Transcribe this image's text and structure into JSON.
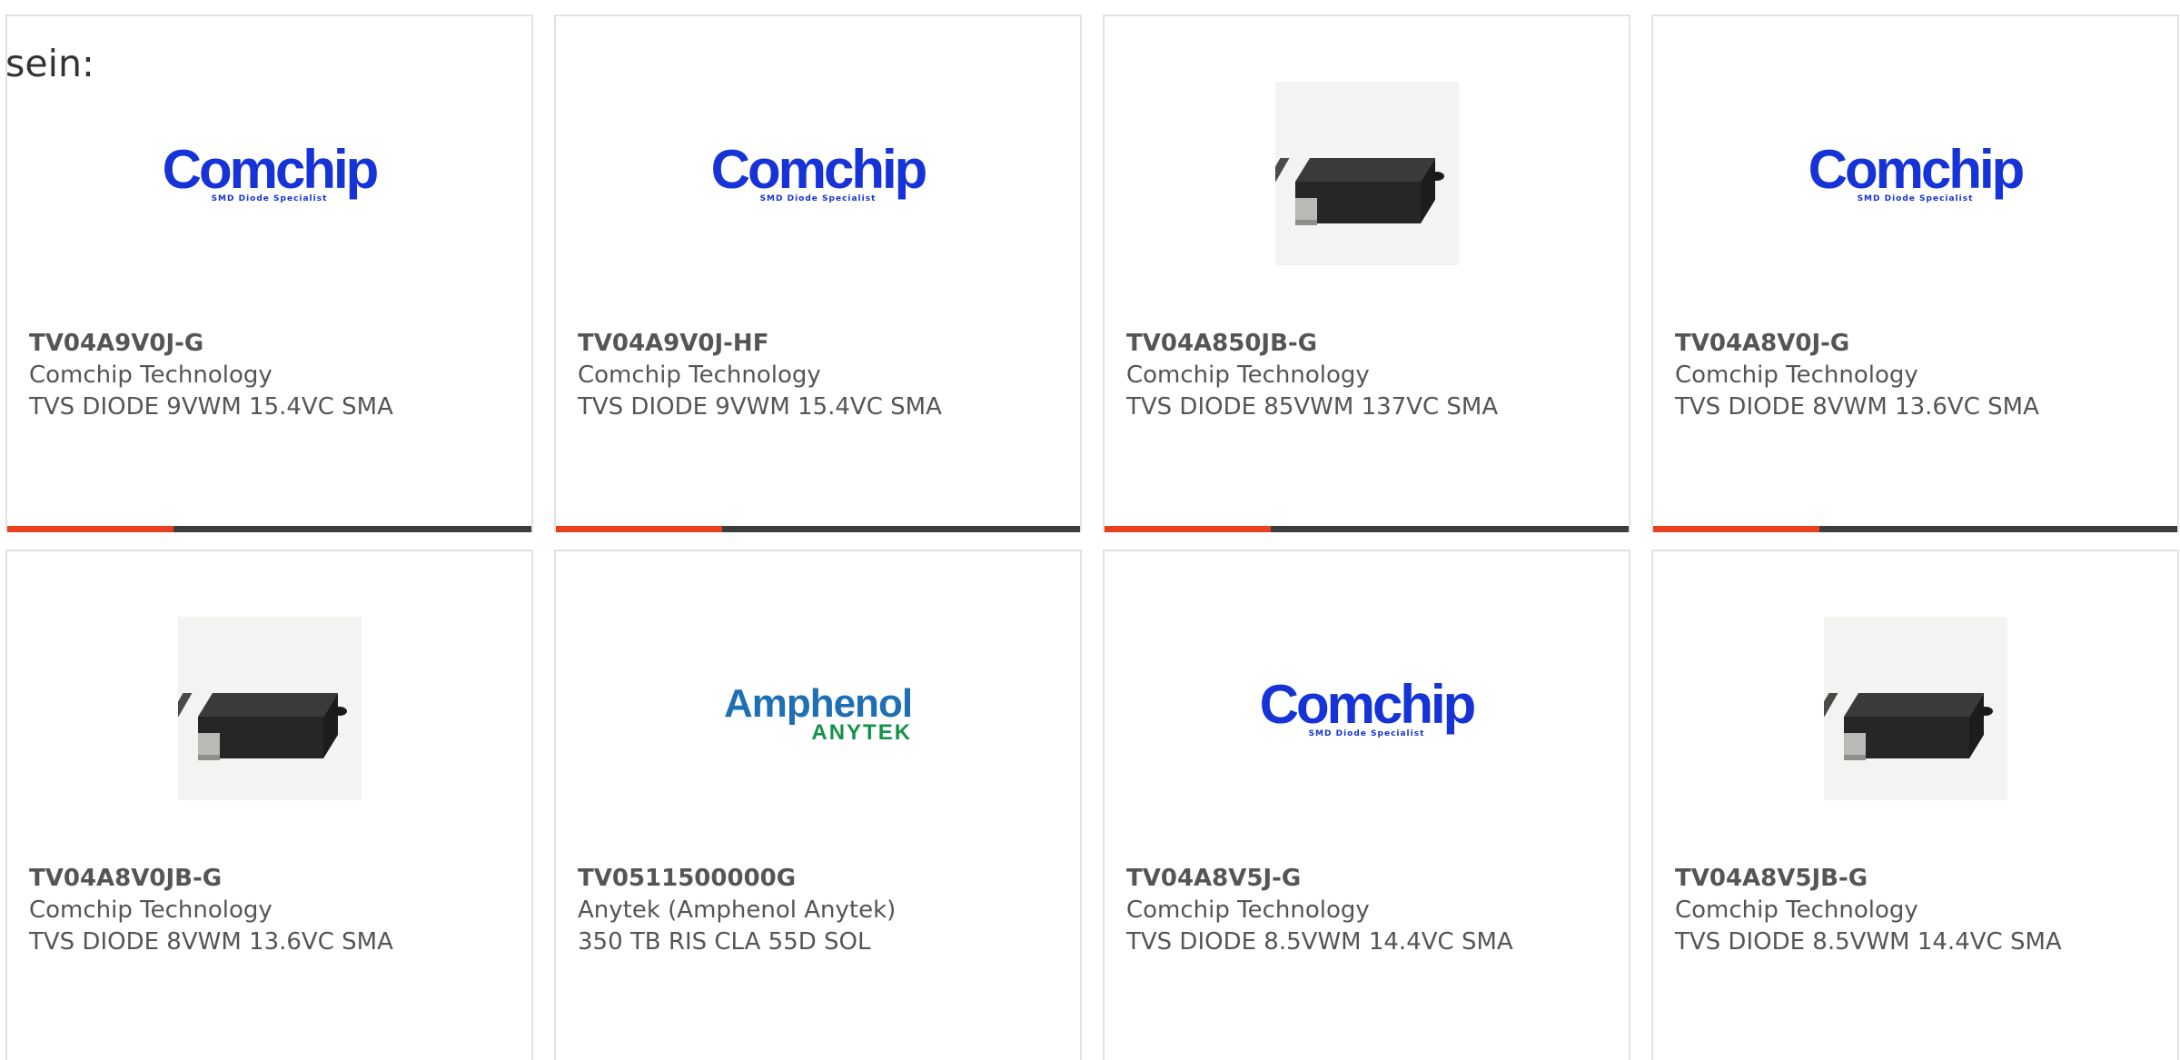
{
  "intro_text": "sein:",
  "accent_color": "#e8401e",
  "bar_color": "#3d3d3d",
  "logos": {
    "comchip": {
      "word": "Comchip",
      "tag": "SMD Diode Specialist"
    },
    "amphenol": {
      "word": "Amphenol",
      "sub": "ANYTEK"
    }
  },
  "products": [
    {
      "part_number": "TV04A9V0J-G",
      "manufacturer": "Comchip Technology",
      "description": "TVS DIODE 9VWM 15.4VC SMA",
      "image": "comchip-logo"
    },
    {
      "part_number": "TV04A9V0J-HF",
      "manufacturer": "Comchip Technology",
      "description": "TVS DIODE 9VWM 15.4VC SMA",
      "image": "comchip-logo"
    },
    {
      "part_number": "TV04A850JB-G",
      "manufacturer": "Comchip Technology",
      "description": "TVS DIODE 85VWM 137VC SMA",
      "image": "sma-package-photo"
    },
    {
      "part_number": "TV04A8V0J-G",
      "manufacturer": "Comchip Technology",
      "description": "TVS DIODE 8VWM 13.6VC SMA",
      "image": "comchip-logo"
    },
    {
      "part_number": "TV04A8V0JB-G",
      "manufacturer": "Comchip Technology",
      "description": "TVS DIODE 8VWM 13.6VC SMA",
      "image": "sma-package-photo"
    },
    {
      "part_number": "TV0511500000G",
      "manufacturer": "Anytek (Amphenol Anytek)",
      "description": "350 TB RIS CLA 55D SOL",
      "image": "amphenol-anytek-logo"
    },
    {
      "part_number": "TV04A8V5J-G",
      "manufacturer": "Comchip Technology",
      "description": "TVS DIODE 8.5VWM 14.4VC SMA",
      "image": "comchip-logo"
    },
    {
      "part_number": "TV04A8V5JB-G",
      "manufacturer": "Comchip Technology",
      "description": "TVS DIODE 8.5VWM 14.4VC SMA",
      "image": "sma-package-photo"
    }
  ]
}
